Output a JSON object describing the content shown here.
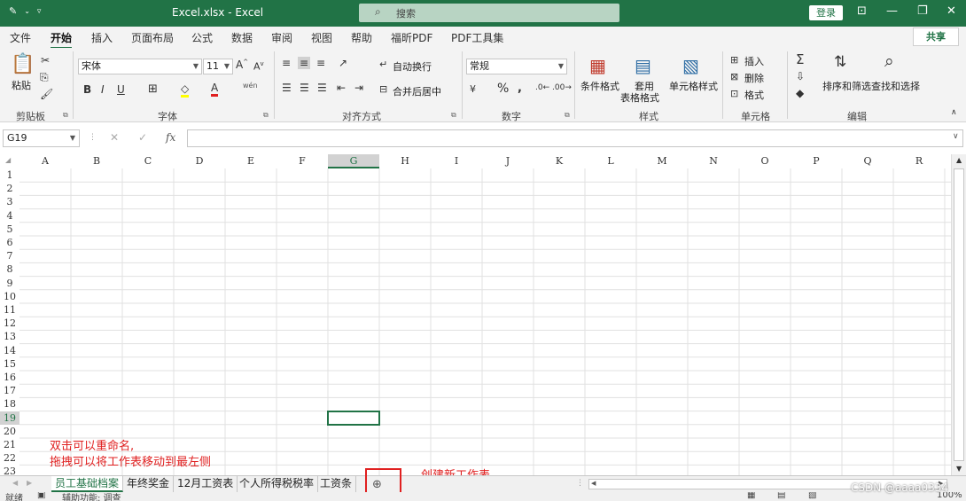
{
  "titlebar": {
    "title": "Excel.xlsx  -  Excel",
    "search_placeholder": "搜索",
    "login": "登录",
    "accent": "#217346"
  },
  "tabs": [
    {
      "label": "文件"
    },
    {
      "label": "开始",
      "active": true
    },
    {
      "label": "插入"
    },
    {
      "label": "页面布局"
    },
    {
      "label": "公式"
    },
    {
      "label": "数据"
    },
    {
      "label": "审阅"
    },
    {
      "label": "视图"
    },
    {
      "label": "帮助"
    },
    {
      "label": "福昕PDF"
    },
    {
      "label": "PDF工具集"
    }
  ],
  "share": "共享",
  "ribbon": {
    "clipboard": {
      "paste": "粘贴",
      "label": "剪贴板"
    },
    "font": {
      "name": "宋体",
      "size": "11",
      "label": "字体",
      "phonetic": "wén"
    },
    "alignment": {
      "wrap": "自动换行",
      "merge": "合并后居中",
      "label": "对齐方式"
    },
    "number": {
      "format": "常规",
      "label": "数字"
    },
    "styles": {
      "conditional": "条件格式",
      "table_format_1": "套用",
      "table_format_2": "表格格式",
      "cell_styles": "单元格样式",
      "label": "样式"
    },
    "cells": {
      "insert": "插入",
      "delete": "删除",
      "format": "格式",
      "label": "单元格"
    },
    "editing": {
      "sort": "排序和筛选",
      "find": "查找和选择",
      "label": "编辑"
    }
  },
  "formula_bar": {
    "namebox": "G19",
    "fx": "fx",
    "value": ""
  },
  "grid": {
    "columns": [
      "A",
      "B",
      "C",
      "D",
      "E",
      "F",
      "G",
      "H",
      "I",
      "J",
      "K",
      "L",
      "M",
      "N",
      "O",
      "P",
      "Q",
      "R"
    ],
    "rows": [
      "1",
      "2",
      "3",
      "4",
      "5",
      "6",
      "7",
      "8",
      "9",
      "10",
      "11",
      "12",
      "13",
      "14",
      "15",
      "16",
      "17",
      "18",
      "19",
      "20",
      "21",
      "22",
      "23"
    ],
    "active_col": "G",
    "active_row": "19"
  },
  "annotations": {
    "rename_1": "双击可以重命名,",
    "rename_2": "拖拽可以将工作表移动到最左侧",
    "new_sheet": "创建新工作表"
  },
  "sheets": [
    {
      "name": "员工基础档案",
      "active": true
    },
    {
      "name": "年终奖金"
    },
    {
      "name": "12月工资表"
    },
    {
      "name": "个人所得税税率"
    },
    {
      "name": "工资条"
    }
  ],
  "statusbar": {
    "ready": "就绪",
    "accessibility": "辅助功能: 调查",
    "zoom": "100%"
  },
  "watermark": "CSDN @aaaa0334"
}
